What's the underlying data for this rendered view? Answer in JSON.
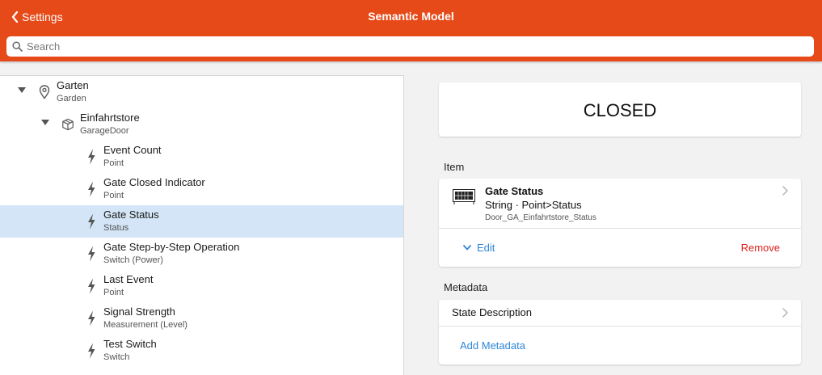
{
  "colors": {
    "accent": "#e64a19",
    "selected_row": "#d3e5f6",
    "link": "#2e86d8",
    "danger": "#e02020"
  },
  "navbar": {
    "back_label": "Settings",
    "title": "Semantic Model"
  },
  "search": {
    "placeholder": "Search",
    "value": ""
  },
  "tree": [
    {
      "label": "Garten",
      "sublabel": "Garden",
      "icon": "location-pin-icon",
      "expanded": true
    },
    {
      "label": "Einfahrtstore",
      "sublabel": "GarageDoor",
      "icon": "box-icon",
      "expanded": true
    },
    {
      "label": "Event Count",
      "sublabel": "Point",
      "icon": "bolt-icon"
    },
    {
      "label": "Gate Closed Indicator",
      "sublabel": "Point",
      "icon": "bolt-icon"
    },
    {
      "label": "Gate Status",
      "sublabel": "Status",
      "icon": "bolt-icon",
      "selected": true
    },
    {
      "label": "Gate Step-by-Step Operation",
      "sublabel": "Switch (Power)",
      "icon": "bolt-icon"
    },
    {
      "label": "Last Event",
      "sublabel": "Point",
      "icon": "bolt-icon"
    },
    {
      "label": "Signal Strength",
      "sublabel": "Measurement (Level)",
      "icon": "bolt-icon"
    },
    {
      "label": "Test Switch",
      "sublabel": "Switch",
      "icon": "bolt-icon"
    }
  ],
  "detail": {
    "state": "CLOSED",
    "item_section_title": "Item",
    "item": {
      "name": "Gate Status",
      "type": "String · Point>Status",
      "id": "Door_GA_Einfahrtstore_Status",
      "edit_label": "Edit",
      "remove_label": "Remove"
    },
    "metadata_section_title": "Metadata",
    "metadata": {
      "state_description_label": "State Description",
      "add_label": "Add Metadata"
    }
  }
}
